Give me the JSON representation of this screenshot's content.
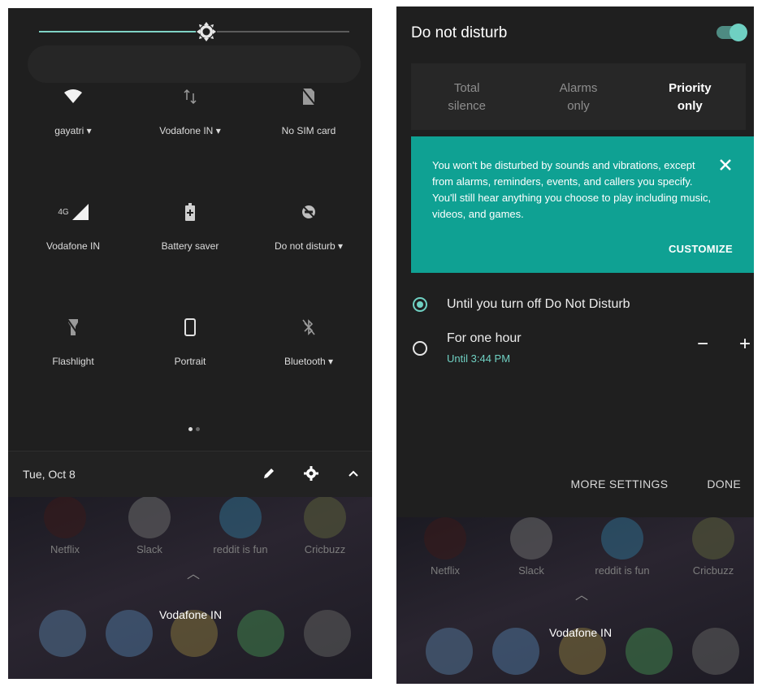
{
  "left_panel": {
    "tiles": [
      {
        "label": "gayatri",
        "dropdown": true,
        "icon": "wifi-icon"
      },
      {
        "label": "Vodafone IN",
        "dropdown": true,
        "icon": "mobile-data-icon"
      },
      {
        "label": "No SIM card",
        "dropdown": false,
        "icon": "no-sim-icon"
      },
      {
        "label": "Vodafone IN",
        "dropdown": false,
        "icon": "signal-4g-icon",
        "icon_text": "4G"
      },
      {
        "label": "Battery saver",
        "dropdown": false,
        "icon": "battery-saver-icon"
      },
      {
        "label": "Do not disturb",
        "dropdown": true,
        "icon": "do-not-disturb-icon"
      },
      {
        "label": "Flashlight",
        "dropdown": false,
        "icon": "flashlight-off-icon"
      },
      {
        "label": "Portrait",
        "dropdown": false,
        "icon": "portrait-icon"
      },
      {
        "label": "Bluetooth",
        "dropdown": true,
        "icon": "bluetooth-off-icon"
      }
    ],
    "brightness_level": 0.54,
    "page_index": 1,
    "page_count": 2,
    "date": "Tue, Oct 8",
    "apps": [
      "Netflix",
      "Slack",
      "reddit is fun",
      "Cricbuzz"
    ],
    "carrier": "Vodafone IN"
  },
  "right_panel": {
    "title": "Do not disturb",
    "enabled": true,
    "modes": [
      {
        "line1": "Total",
        "line2": "silence",
        "selected": false
      },
      {
        "line1": "Alarms",
        "line2": "only",
        "selected": false
      },
      {
        "line1": "Priority",
        "line2": "only",
        "selected": true
      }
    ],
    "info": "You won't be disturbed by sounds and vibrations, except from alarms, reminders, events, and callers you specify. You'll still hear anything you choose to play including music, videos, and games.",
    "customize": "CUSTOMIZE",
    "option1": "Until you turn off Do Not Disturb",
    "option2_title": "For one hour",
    "option2_sub": "Until 3:44 PM",
    "minus": "−",
    "plus": "+",
    "more_settings": "MORE SETTINGS",
    "done": "DONE",
    "apps": [
      "Netflix",
      "Slack",
      "reddit is fun",
      "Cricbuzz"
    ],
    "carrier": "Vodafone IN"
  },
  "colors": {
    "accent": "#6fd0c2",
    "card": "#0fa193",
    "background": "#1f1f1f"
  }
}
